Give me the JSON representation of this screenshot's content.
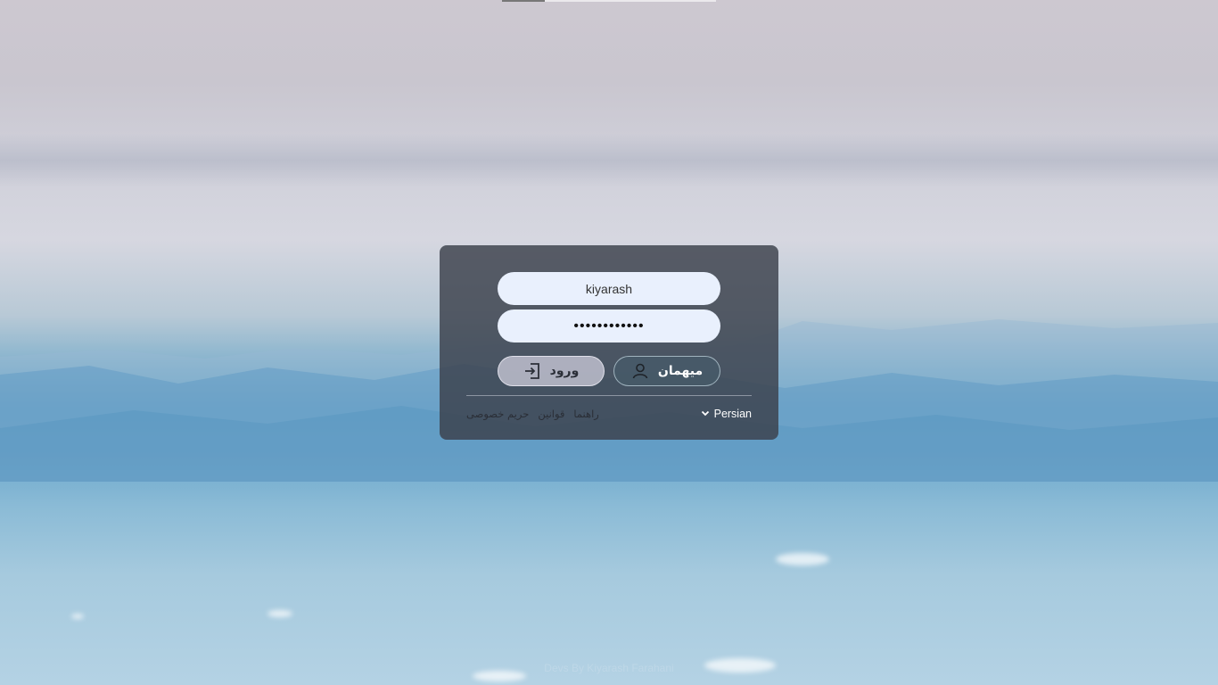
{
  "login_form": {
    "username_value": "kiyarash",
    "password_value": "••••••••••••",
    "login_button_label": "ورود",
    "guest_button_label": "میهمان"
  },
  "footer": {
    "links": [
      "راهنما",
      "قوانین",
      "حریم خصوصی"
    ],
    "language": "Persian"
  },
  "credit_text": "Devs By Kiyarash Farahani",
  "colors": {
    "panel_bg": "#3a404a",
    "field_bg": "#e9f0fd",
    "login_button_bg": "#bec0ce",
    "guest_button_bg": "#465a69"
  },
  "icons": {
    "login": "login-arrow-icon",
    "guest": "user-icon",
    "language": "chevron-down-icon"
  }
}
